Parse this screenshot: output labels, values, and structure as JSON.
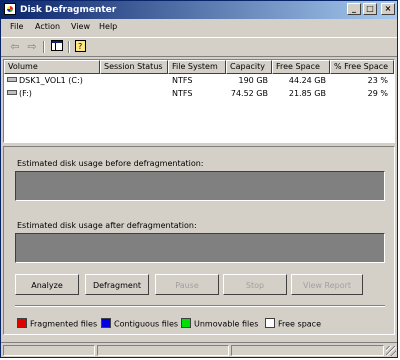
{
  "window": {
    "title": "Disk Defragmenter"
  },
  "menu": [
    "File",
    "Action",
    "View",
    "Help"
  ],
  "toolbar": {
    "back_icon": "back-arrow-icon",
    "forward_icon": "forward-arrow-icon",
    "console_tree_icon": "console-tree-icon",
    "help_icon": "help-icon"
  },
  "table": {
    "columns": [
      "Volume",
      "Session Status",
      "File System",
      "Capacity",
      "Free Space",
      "% Free Space"
    ],
    "rows": [
      {
        "volume": "DSK1_VOL1 (C:)",
        "status": "",
        "fs": "NTFS",
        "capacity": "190 GB",
        "free": "44.24 GB",
        "pct": "23 %"
      },
      {
        "volume": "(F:)",
        "status": "",
        "fs": "NTFS",
        "capacity": "74.52 GB",
        "free": "21.85 GB",
        "pct": "29 %"
      }
    ]
  },
  "labels": {
    "before": "Estimated disk usage before defragmentation:",
    "after": "Estimated disk usage after defragmentation:"
  },
  "buttons": {
    "analyze": "Analyze",
    "defragment": "Defragment",
    "pause": "Pause",
    "stop": "Stop",
    "view_report": "View Report"
  },
  "legend": [
    {
      "label": "Fragmented files",
      "color": "#e00000"
    },
    {
      "label": "Contiguous files",
      "color": "#0000e0"
    },
    {
      "label": "Unmovable files",
      "color": "#00e000"
    },
    {
      "label": "Free space",
      "color": "#ffffff"
    }
  ],
  "colors": {
    "bar_fill": "#808080",
    "titlebar": "#0a246a"
  }
}
